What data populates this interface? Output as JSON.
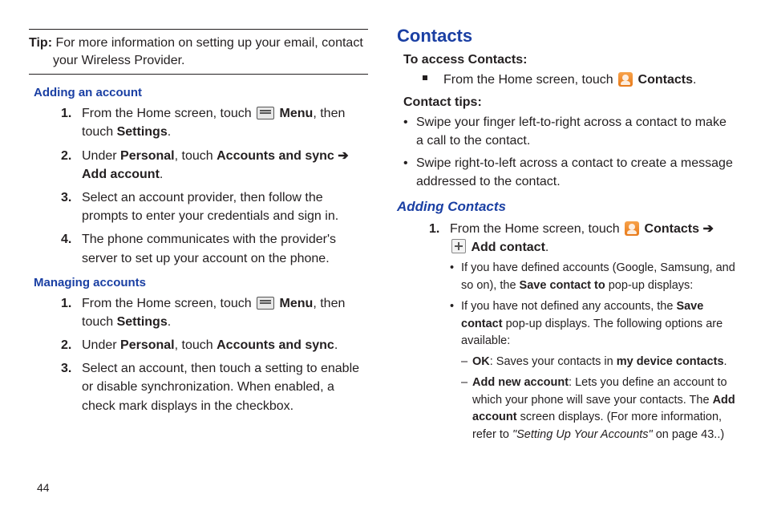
{
  "left": {
    "tip": {
      "label": "Tip:",
      "line1": " For more information on setting up your email, contact",
      "line2": "your Wireless Provider."
    },
    "adding_heading": "Adding an account",
    "adding_steps": {
      "s1a": "From the Home screen, touch ",
      "s1_menu": " Menu",
      "s1b": ", then touch ",
      "s1_settings": "Settings",
      "s1_end": ".",
      "s2a": "Under ",
      "s2_personal": "Personal",
      "s2b": ", touch ",
      "s2_accsync": "Accounts and sync",
      "s2_arrow": " ➔ ",
      "s2_addacct": "Add account",
      "s2_end": ".",
      "s3": "Select an account provider, then follow the prompts to enter your credentials and sign in.",
      "s4": "The phone communicates with the provider's server to set up your account on the phone."
    },
    "managing_heading": "Managing accounts",
    "managing_steps": {
      "s1a": "From the Home screen, touch ",
      "s1_menu": " Menu",
      "s1b": ", then touch ",
      "s1_settings": "Settings",
      "s1_end": ".",
      "s2a": "Under ",
      "s2_personal": "Personal",
      "s2b": ", touch ",
      "s2_accsync": "Accounts and sync",
      "s2_end": ".",
      "s3": "Select an account, then touch a setting to enable or disable synchronization. When enabled, a check mark displays in the checkbox."
    }
  },
  "right": {
    "contacts_heading": "Contacts",
    "to_access": "To access Contacts:",
    "access_a": "From the Home screen, touch ",
    "access_contacts": " Contacts",
    "access_end": ".",
    "tips_heading": "Contact tips:",
    "tip1": "Swipe your finger left-to-right across a contact to make a call to the contact.",
    "tip2": "Swipe right-to-left across a contact to create a message addressed to the contact.",
    "adding_heading": "Adding Contacts",
    "s1a": "From the Home screen, touch ",
    "s1_contacts": " Contacts ",
    "s1_arrow": " ➔ ",
    "s1_addcontact": " Add contact",
    "s1_end": ".",
    "sub1a": "If you have defined accounts (Google, Samsung, and so on), the ",
    "sub1_save": "Save contact to",
    "sub1b": " pop-up displays:",
    "sub2a": "If you have not defined any accounts, the ",
    "sub2_save": "Save contact",
    "sub2b": " pop-up displays. The following options are available:",
    "d1_ok": "OK",
    "d1a": ": Saves your contacts in ",
    "d1_mdc": "my device contacts",
    "d1_end": ".",
    "d2_add": "Add new account",
    "d2a": ": Lets you define an account to which your phone will save your contacts. The  ",
    "d2_addacct": "Add account",
    "d2b": " screen displays. (For more information, refer to ",
    "d2_ref": "\"Setting Up Your Accounts\"",
    "d2c": "  on page 43..)"
  },
  "pagenum": "44"
}
